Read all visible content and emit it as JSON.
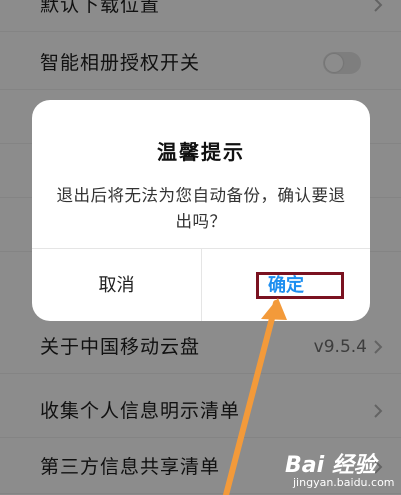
{
  "settings": {
    "rows": [
      {
        "label": "默认下载位置"
      },
      {
        "label": "智能相册授权开关"
      },
      {
        "label": ""
      },
      {
        "label": ""
      },
      {
        "label": ""
      },
      {
        "label": "关于中国移动云盘",
        "value": "v9.5.4"
      },
      {
        "label": "收集个人信息明示清单"
      },
      {
        "label": "第三方信息共享清单"
      }
    ]
  },
  "dialog": {
    "title": "温馨提示",
    "message": "退出后将无法为您自动备份，确认要退出吗？",
    "cancel_label": "取消",
    "confirm_label": "确定"
  },
  "watermark": {
    "logo": "Bai 经验",
    "url": "jingyan.baidu.com"
  },
  "colors": {
    "accent": "#1e8ff0",
    "highlight_box": "#7a1220",
    "arrow": "#f39a3a"
  }
}
